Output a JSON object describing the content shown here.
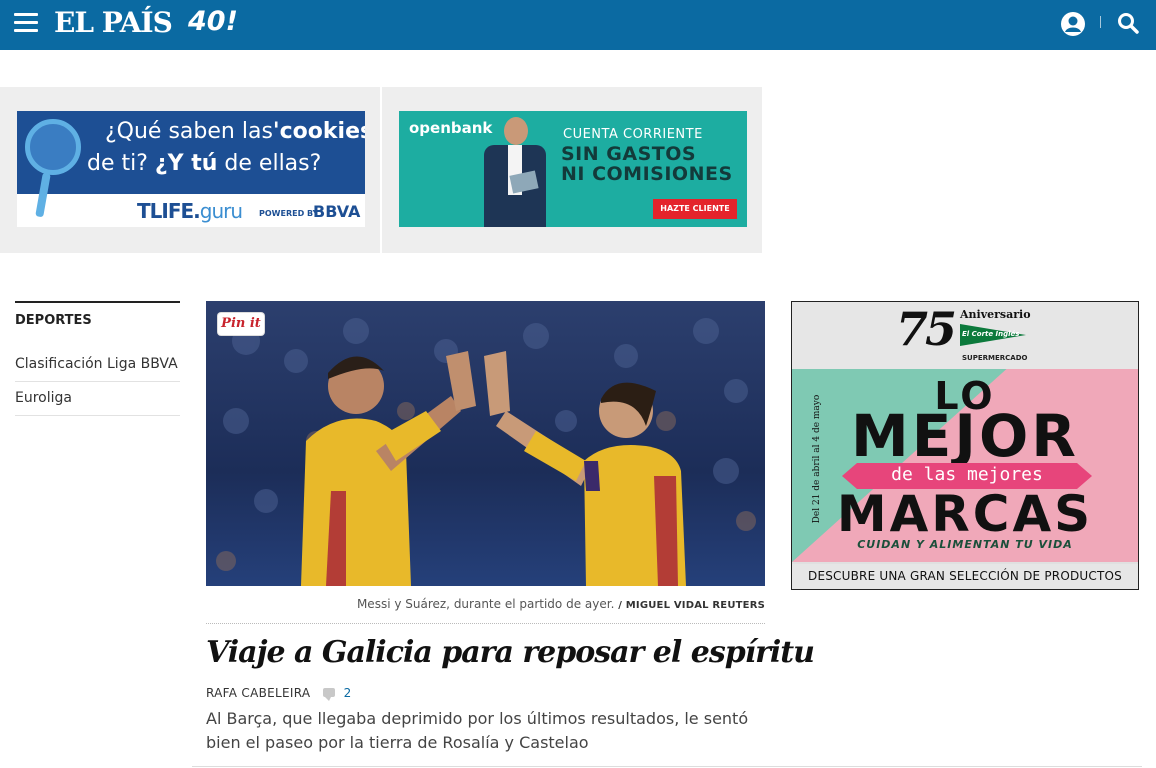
{
  "header": {
    "logo": "EL PAÍS",
    "logo_badge": "40!"
  },
  "ads": {
    "bbva": {
      "question_prefix": "¿Qué saben las",
      "question_bold": "'cookies'",
      "line2_prefix": "de ti? ",
      "line2_bold": "¿Y tú",
      "line2_suffix": " de ellas?",
      "brand": "TLIFE.",
      "brand_suffix": "guru",
      "powered_by": "POWERED BY",
      "sponsor": "BBVA"
    },
    "openbank": {
      "logo": "openbank",
      "line1": "CUENTA CORRIENTE",
      "line2": "SIN GASTOS",
      "line3": "NI COMISIONES",
      "cta": "HAZTE CLIENTE"
    },
    "eci": {
      "number": "75",
      "anniversary": "Aniversario",
      "store": "El Corte Inglés",
      "supermarket": "SUPERMERCADO",
      "dates": "Del 21 de abril al 4 de mayo",
      "headline_lo": "LO",
      "headline_mejor": "MEJOR",
      "headline_de": "de las mejores",
      "headline_marcas": "MARCAS",
      "tagline": "CUIDAN Y ALIMENTAN TU VIDA",
      "footer": "DESCUBRE UNA GRAN SELECCIÓN DE PRODUCTOS"
    }
  },
  "sidebar": {
    "title": "DEPORTES",
    "items": [
      {
        "label": "Clasificación Liga BBVA"
      },
      {
        "label": "Euroliga"
      }
    ]
  },
  "article": {
    "pinit": "Pin it",
    "caption": "Messi y Suárez, durante el partido de ayer.",
    "credit": "/ MIGUEL VIDAL REUTERS",
    "headline": "Viaje a Galicia para reposar el espíritu",
    "author": "RAFA CABELEIRA",
    "comments": "2",
    "standfirst": "Al Barça, que llegaba deprimido por los últimos resultados, le sentó bien el paseo por la tierra de Rosalía y Castelao"
  },
  "colors": {
    "brand_blue": "#0b6aa2",
    "ad_band": "#eeeeee",
    "openbank_teal": "#1dada1",
    "bbva_blue": "#1d4f94",
    "eci_pink": "#f0a8b9",
    "eci_green": "#7fc9b3"
  },
  "icons": {
    "menu": "hamburger-menu-icon",
    "user": "user-account-icon",
    "search": "search-icon",
    "comment": "comment-bubble-icon"
  }
}
